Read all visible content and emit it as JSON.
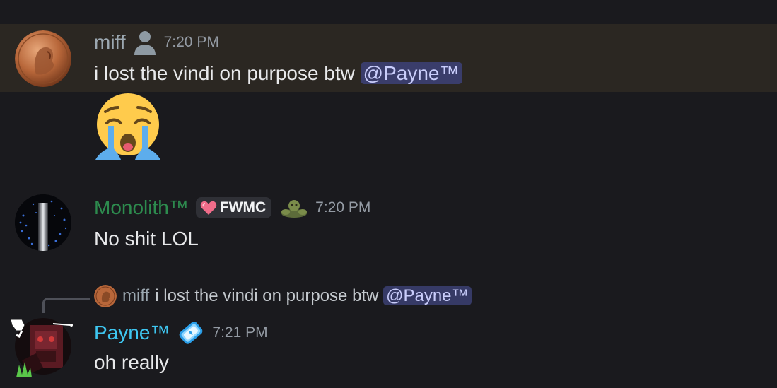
{
  "messages": [
    {
      "username": "miff",
      "user_color": "#9ba7b0",
      "timestamp": "7:20 PM",
      "text": "i lost the vindi on purpose btw ",
      "mention": "@Payne™",
      "attachment_emoji": "loudly-crying-face-emoji"
    },
    {
      "username": "Monolith™",
      "user_color": "#2d8b4e",
      "tag": "FWMC",
      "timestamp": "7:20 PM",
      "text": "No shit LOL"
    },
    {
      "reply": {
        "username": "miff",
        "text": "i lost the vindi on purpose btw",
        "mention": "@Payne™"
      },
      "username": "Payne™",
      "user_color": "#3ec6f0",
      "timestamp": "7:21 PM",
      "text": "oh really"
    }
  ],
  "colors": {
    "background": "#1a1a1e",
    "highlight": "#2b2722",
    "mention_bg": "#3a3d6b",
    "mention_text": "#c9cdfb"
  }
}
